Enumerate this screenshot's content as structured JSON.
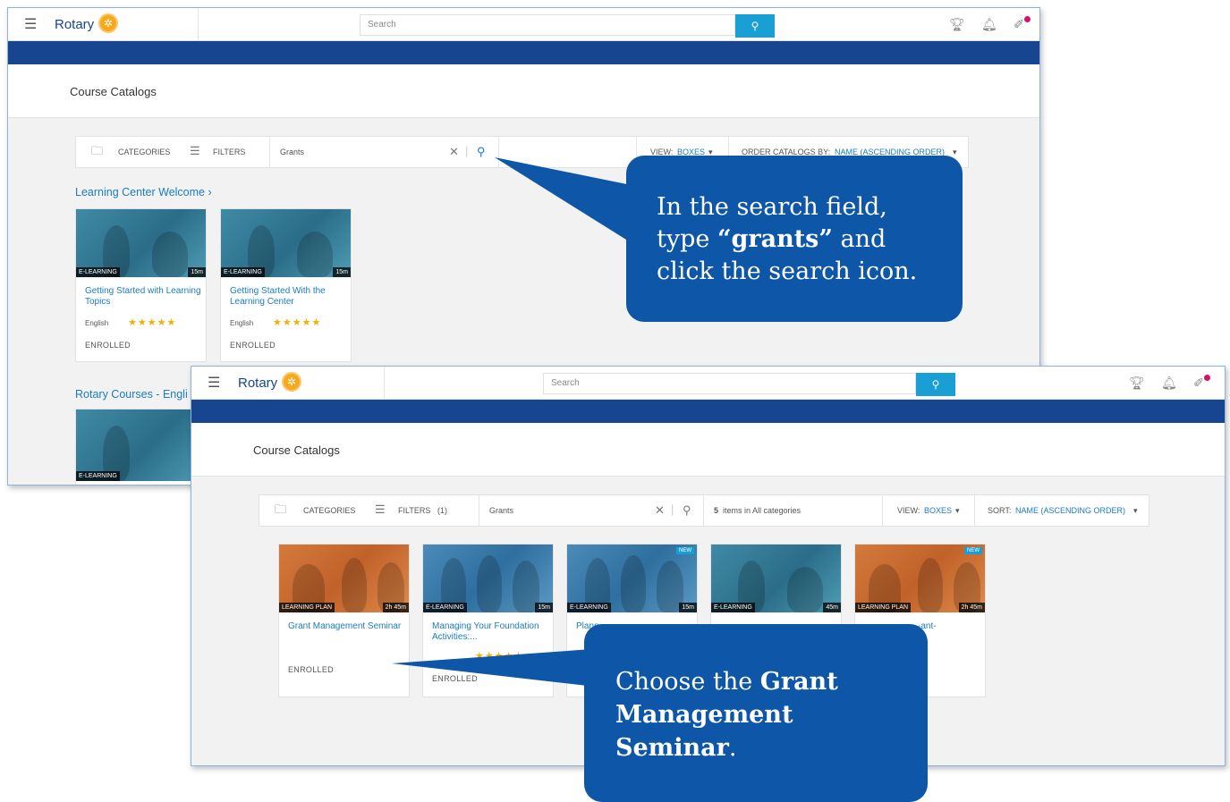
{
  "screen1": {
    "logo_text": "Rotary",
    "search_placeholder": "Search",
    "page_title": "Course Catalogs",
    "toolbar": {
      "categories_label": "CATEGORIES",
      "filters_label": "FILTERS",
      "search_value": "Grants",
      "view_label": "VIEW:",
      "view_value": "BOXES",
      "order_label": "ORDER CATALOGS BY:",
      "order_value": "NAME (ASCENDING ORDER)"
    },
    "section1_link": "Learning Center Welcome",
    "section1_chevron": "›",
    "section2_link": "Rotary Courses - Engli",
    "cards": [
      {
        "type": "E-LEARNING",
        "duration": "15m",
        "title": "Getting Started with Learning Topics",
        "language": "English",
        "stars": "★★★★★",
        "status": "ENROLLED"
      },
      {
        "type": "E-LEARNING",
        "duration": "15m",
        "title": "Getting Started With the Learning Center",
        "language": "English",
        "stars": "★★★★★",
        "status": "ENROLLED"
      }
    ],
    "partial_card_type": "E-LEARNING"
  },
  "screen2": {
    "logo_text": "Rotary",
    "search_placeholder": "Search",
    "page_title": "Course Catalogs",
    "toolbar": {
      "categories_label": "CATEGORIES",
      "filters_label": "FILTERS",
      "filters_count": "(1)",
      "search_value": "Grants",
      "results_count": "5",
      "results_text": "items in All categories",
      "view_label": "VIEW:",
      "view_value": "BOXES",
      "sort_label": "SORT:",
      "sort_value": "NAME (ASCENDING ORDER)"
    },
    "cards": [
      {
        "type": "LEARNING PLAN",
        "duration": "2h 45m",
        "title": "Grant Management Seminar",
        "status": "ENROLLED"
      },
      {
        "type": "E-LEARNING",
        "duration": "15m",
        "title": "Managing Your Foundation Activities:...",
        "status": "ENROLLED"
      },
      {
        "type": "E-LEARNING",
        "duration": "15m",
        "new": "NEW",
        "title": "Plann"
      },
      {
        "type": "E-LEARNING",
        "duration": "45m"
      },
      {
        "type": "LEARNING PLAN",
        "duration": "2h 45m",
        "new": "NEW",
        "title": "-ant-"
      }
    ]
  },
  "callouts": {
    "first": {
      "line1": "In the search field,",
      "line2_pre": "type ",
      "line2_bold": "“grants”",
      "line2_post": " and",
      "line3": "click the search icon."
    },
    "second": {
      "line1_pre": "Choose the ",
      "line1_bold": "Grant",
      "line2_bold": "Management",
      "line3_bold": "Seminar",
      "line3_post": "."
    }
  },
  "icons": {
    "menu": "hamburger-menu-icon",
    "search": "magnifier-icon",
    "trophy": "trophy-icon",
    "bell": "bell-icon",
    "badge": "badge-icon",
    "folder": "folder-icon",
    "filter": "filter-icon",
    "clear": "clear-icon"
  },
  "colors": {
    "rotary_blue": "#17458f",
    "search_button": "#1a9fd4",
    "link_blue": "#1a7cc2",
    "callout": "#0e56a8",
    "star": "#f2b100",
    "rotary_gold": "#f7a81b"
  }
}
